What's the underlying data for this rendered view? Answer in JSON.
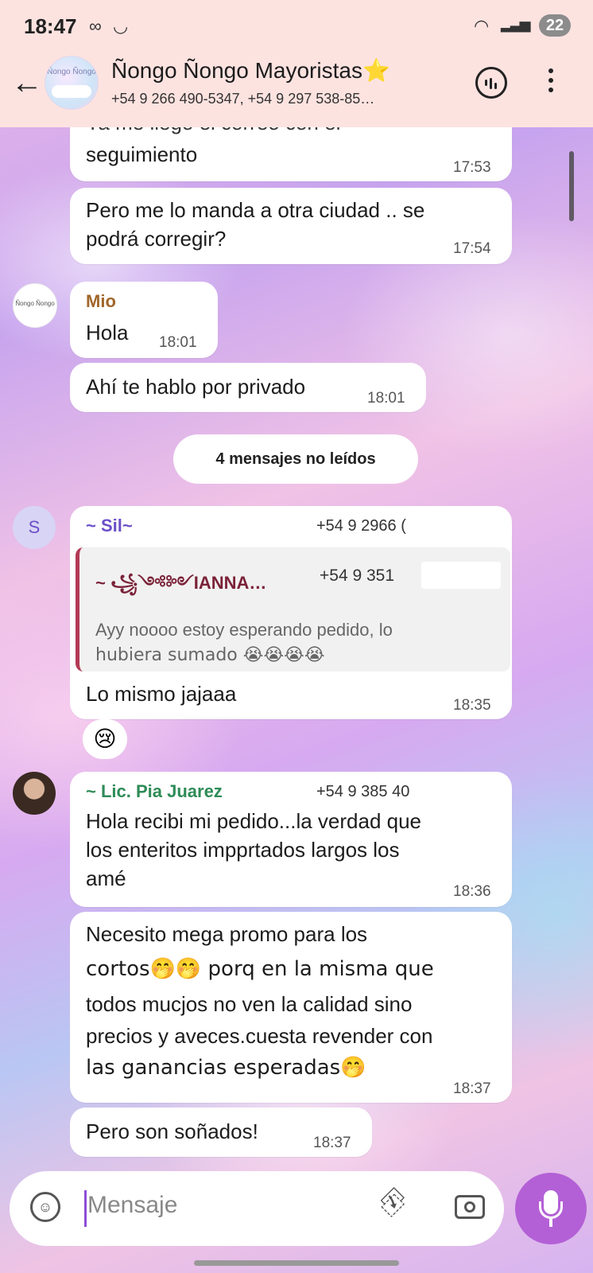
{
  "status_bar": {
    "time": "18:47",
    "battery": "22"
  },
  "header": {
    "title": "Ñongo Ñongo Mayoristas⭐",
    "subtitle": "+54 9 266 490-5347, +54 9 297 538-85…",
    "avatar_text": "Ñongo Ñongo"
  },
  "messages": [
    {
      "text_line1": "Ya me llegó el correo con el",
      "text_line2": "seguimiento",
      "time": "17:53"
    },
    {
      "text_line1": "Pero me lo manda a otra ciudad .. se",
      "text_line2": "podrá corregir?",
      "time": "17:54"
    },
    {
      "sender": "Mio",
      "text": "Hola",
      "time": "18:01",
      "avatar_text": "Ñongo Ñongo"
    },
    {
      "text": "Ahí te hablo por privado",
      "time": "18:01"
    }
  ],
  "unread_separator": "4 mensajes no leídos",
  "sil_message": {
    "avatar_letter": "S",
    "sender": "~ Sil~",
    "phone": "+54 9 2966 (",
    "quote_sender": "~ ꧁༺༻IANNA…",
    "quote_phone": "+54 9 351 ",
    "quote_text_line1": "Ayy noooo estoy esperando pedido, lo",
    "quote_text_line2": "hubiera sumado 😭😭😭😭",
    "text": "Lo mismo jajaaa",
    "time": "18:35",
    "reaction": "😢"
  },
  "pia_messages": {
    "sender": "~ Lic. Pia Juarez",
    "phone": "+54 9 385 40",
    "msg1_line1": "Hola recibi mi pedido...la verdad que",
    "msg1_line2": "los enteritos impprtados largos los",
    "msg1_line3": "amé",
    "msg1_time": "18:36",
    "msg2_line1": "Necesito mega promo para los",
    "msg2_line2": "cortos🤭🤭 porq en la misma que",
    "msg2_line3": "todos mucjos no ven la calidad sino",
    "msg2_line4": "precios y aveces.cuesta revender con",
    "msg2_line5": "las ganancias esperadas🤭",
    "msg2_time": "18:37",
    "msg3_text": "Pero son soñados!",
    "msg3_time": "18:37"
  },
  "composer": {
    "placeholder": "Mensaje"
  },
  "colors": {
    "header_bg": "#fde3e0",
    "sil_name": "#6c4fc9",
    "mio_name": "#a0662a",
    "pia_name": "#2e8b57",
    "quote_bar": "#b23a55",
    "mic_button": "#b360d6"
  }
}
